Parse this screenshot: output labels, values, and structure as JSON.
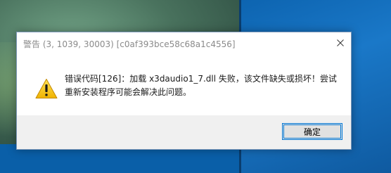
{
  "dialog": {
    "title": "警告 (3, 1039, 30003) [c0af393bce58c68a1c4556]",
    "message": "错误代码[126]：加载 x3daudio1_7.dll 失败，该文件缺失或损坏！尝试重新安装程序可能会解决此问题。",
    "ok_label": "确定",
    "icon": "warning-icon",
    "close_icon": "close-icon"
  },
  "colors": {
    "accent": "#0078d7",
    "warning_yellow": "#f5c400",
    "footer_bg": "#f0f0f0",
    "title_text": "#8a8a8a"
  }
}
